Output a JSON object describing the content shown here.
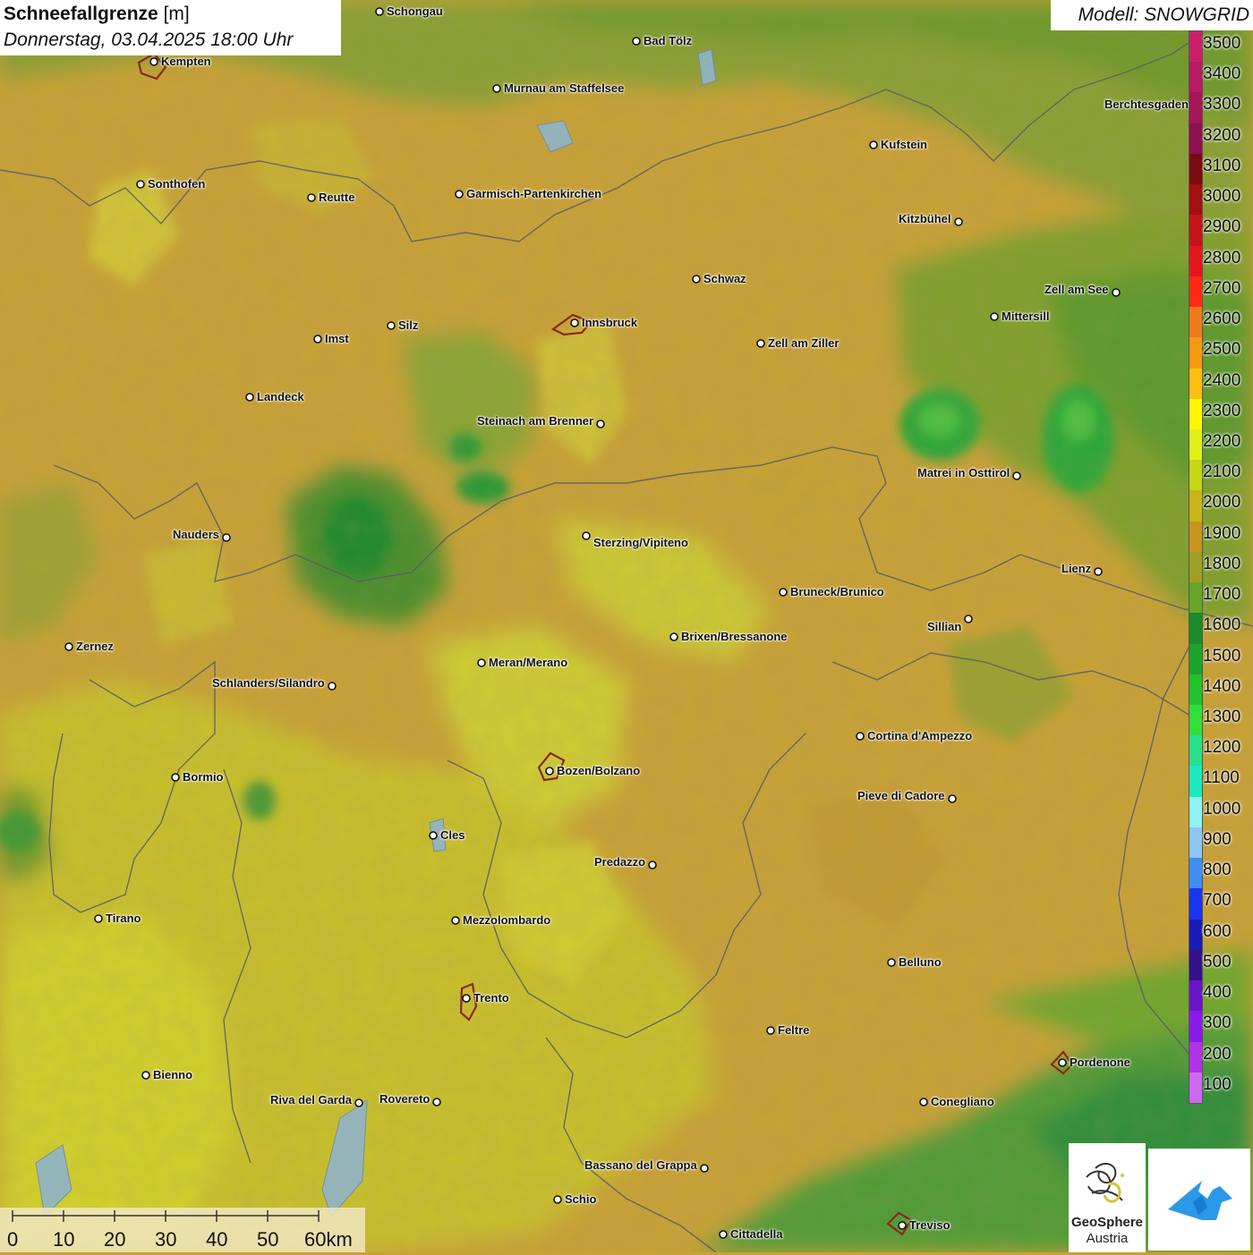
{
  "header": {
    "title_bold": "Schneefallgrenze",
    "title_unit": "[m]",
    "subtitle": "Donnerstag, 03.04.2025 18:00 Uhr",
    "model": "Modell: SNOWGRID"
  },
  "cities": [
    {
      "name": "Schongau"
    },
    {
      "name": "Bad Tölz"
    },
    {
      "name": "Kempten"
    },
    {
      "name": "Murnau am Staffelsee"
    },
    {
      "name": "Berchtesgaden"
    },
    {
      "name": "Kufstein"
    },
    {
      "name": "Sonthofen"
    },
    {
      "name": "Reutte"
    },
    {
      "name": "Garmisch-Partenkirchen"
    },
    {
      "name": "Kitzbühel"
    },
    {
      "name": "Schwaz"
    },
    {
      "name": "Zell am See"
    },
    {
      "name": "Innsbruck"
    },
    {
      "name": "Mittersill"
    },
    {
      "name": "Silz"
    },
    {
      "name": "Imst"
    },
    {
      "name": "Zell am Ziller"
    },
    {
      "name": "Landeck"
    },
    {
      "name": "Steinach am Brenner"
    },
    {
      "name": "Matrei in Osttirol"
    },
    {
      "name": "Nauders"
    },
    {
      "name": "Sterzing/Vipiteno"
    },
    {
      "name": "Lienz"
    },
    {
      "name": "Bruneck/Brunico"
    },
    {
      "name": "Sillian"
    },
    {
      "name": "Brixen/Bressanone"
    },
    {
      "name": "Zernez"
    },
    {
      "name": "Meran/Merano"
    },
    {
      "name": "Schlanders/Silandro"
    },
    {
      "name": "Cortina d'Ampezzo"
    },
    {
      "name": "Bozen/Bolzano"
    },
    {
      "name": "Bormio"
    },
    {
      "name": "Pieve di Cadore"
    },
    {
      "name": "Cles"
    },
    {
      "name": "Predazzo"
    },
    {
      "name": "Tirano"
    },
    {
      "name": "Mezzolombardo"
    },
    {
      "name": "Belluno"
    },
    {
      "name": "Trento"
    },
    {
      "name": "Feltre"
    },
    {
      "name": "Pordenone"
    },
    {
      "name": "Bienno"
    },
    {
      "name": "Riva del Garda"
    },
    {
      "name": "Rovereto"
    },
    {
      "name": "Conegliano"
    },
    {
      "name": "Bassano del Grappa"
    },
    {
      "name": "Schio"
    },
    {
      "name": "Treviso"
    },
    {
      "name": "Cittadella"
    }
  ],
  "legend": {
    "levels": [
      {
        "value": "3500",
        "color": "#cc1f6a"
      },
      {
        "value": "3400",
        "color": "#b81a63"
      },
      {
        "value": "3300",
        "color": "#a5155a"
      },
      {
        "value": "3200",
        "color": "#8e1050"
      },
      {
        "value": "3100",
        "color": "#7a0b12"
      },
      {
        "value": "3000",
        "color": "#a40f12"
      },
      {
        "value": "2900",
        "color": "#c41418"
      },
      {
        "value": "2800",
        "color": "#e3161b"
      },
      {
        "value": "2700",
        "color": "#ff2a12"
      },
      {
        "value": "2600",
        "color": "#f07a1a"
      },
      {
        "value": "2500",
        "color": "#f59a10"
      },
      {
        "value": "2400",
        "color": "#fbbf12"
      },
      {
        "value": "2300",
        "color": "#fff700"
      },
      {
        "value": "2200",
        "color": "#def21a"
      },
      {
        "value": "2100",
        "color": "#c6d614"
      },
      {
        "value": "2000",
        "color": "#c8b61a"
      },
      {
        "value": "1900",
        "color": "#c8951e"
      },
      {
        "value": "1800",
        "color": "#a0a024"
      },
      {
        "value": "1700",
        "color": "#67a52a"
      },
      {
        "value": "1600",
        "color": "#1b8a2a"
      },
      {
        "value": "1500",
        "color": "#1aa52a"
      },
      {
        "value": "1400",
        "color": "#22c22c"
      },
      {
        "value": "1300",
        "color": "#32de3a"
      },
      {
        "value": "1200",
        "color": "#27e08c"
      },
      {
        "value": "1100",
        "color": "#1ee8c0"
      },
      {
        "value": "1000",
        "color": "#8ff3f3"
      },
      {
        "value": "900",
        "color": "#8fc4f0"
      },
      {
        "value": "800",
        "color": "#3f8ef0"
      },
      {
        "value": "700",
        "color": "#1a35f0"
      },
      {
        "value": "600",
        "color": "#1a1ab8"
      },
      {
        "value": "500",
        "color": "#34108a"
      },
      {
        "value": "400",
        "color": "#6a14c8"
      },
      {
        "value": "300",
        "color": "#8a1ae8"
      },
      {
        "value": "200",
        "color": "#b033e8"
      },
      {
        "value": "100",
        "color": "#cc6af0"
      }
    ]
  },
  "scale": {
    "ticks": [
      "0",
      "10",
      "20",
      "30",
      "40",
      "50",
      "60km"
    ]
  },
  "logo": {
    "line1": "GeoSphere",
    "line2": "Austria"
  }
}
